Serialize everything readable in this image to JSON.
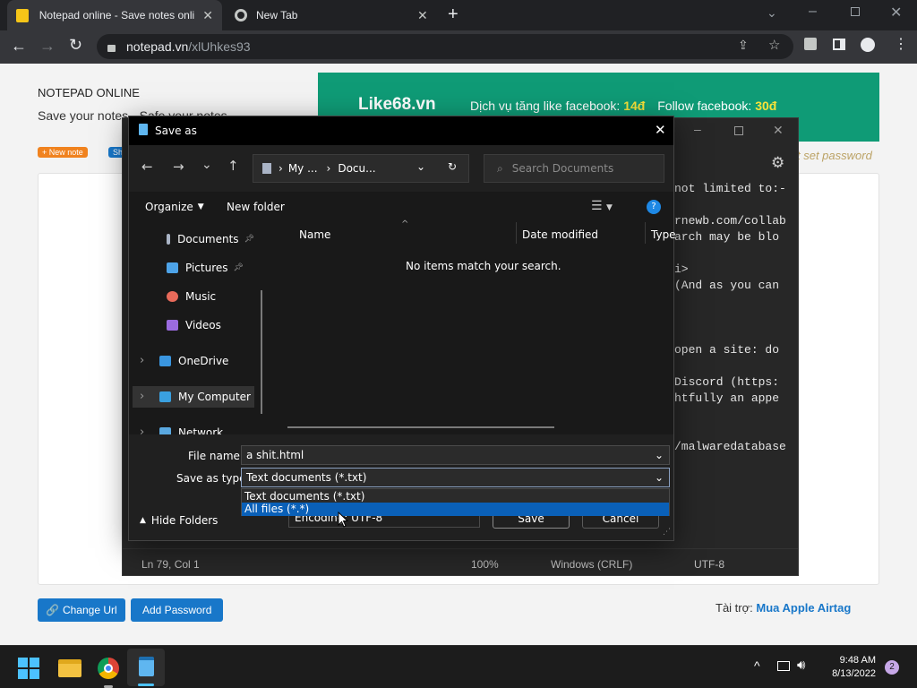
{
  "browser": {
    "tabs": [
      {
        "title": "Notepad online - Save notes onli",
        "active": true
      },
      {
        "title": "New Tab",
        "active": false
      }
    ],
    "url_host": "notepad.vn",
    "url_path": "/xlUhkes93"
  },
  "page": {
    "brand": "NOTEPAD ONLINE",
    "tagline": "Save your notes - Safe your notes",
    "new_note_badge": "+ New note",
    "share_badge": "Sh",
    "ad": {
      "site": "Like68.vn",
      "t1": "Dịch vụ tăng like facebook: ",
      "v1": "14đ",
      "t2": "Follow facebook: ",
      "v2": "30đ"
    },
    "set_password_hint": "t set password",
    "change_url_label": "Change Url",
    "add_password_label": "Add Password",
    "sponsor_label": "Tài trợ: ",
    "sponsor_link": "Mua Apple Airtag"
  },
  "notepad": {
    "visible_lines": [
      "not limited to:-",
      "",
      "rnewb.com/collab",
      "arch may be blo",
      "",
      "i>",
      "(And as you can",
      "",
      "",
      "",
      "open a site: do",
      "",
      "Discord (https:",
      "htfully an appe",
      "",
      "",
      "/malwaredatabase"
    ],
    "status": {
      "position": "Ln 79, Col 1",
      "zoom": "100%",
      "eol": "Windows (CRLF)",
      "encoding": "UTF-8"
    }
  },
  "dialog": {
    "title": "Save as",
    "breadcrumb": [
      "My ...",
      "Docu..."
    ],
    "search_placeholder": "Search Documents",
    "organize_label": "Organize",
    "new_folder_label": "New folder",
    "nav_items": [
      {
        "label": "Documents",
        "icon": "documents-icon",
        "pinned": true
      },
      {
        "label": "Pictures",
        "icon": "pictures-icon",
        "pinned": true
      },
      {
        "label": "Music",
        "icon": "music-icon",
        "pinned": false
      },
      {
        "label": "Videos",
        "icon": "videos-icon",
        "pinned": false
      },
      {
        "label": "OneDrive",
        "icon": "onedrive-icon",
        "expandable": true
      },
      {
        "label": "My Computer",
        "icon": "computer-icon",
        "expandable": true,
        "selected": true
      },
      {
        "label": "Network",
        "icon": "network-icon",
        "expandable": true
      }
    ],
    "columns": [
      "Name",
      "Date modified",
      "Type"
    ],
    "empty_message": "No items match your search.",
    "file_name_label": "File name:",
    "file_name_value": "a shit.html",
    "save_type_label": "Save as type:",
    "save_type_value": "Text documents (*.txt)",
    "type_options": [
      "Text documents (*.txt)",
      "All files  (*.*)"
    ],
    "highlighted_option": 1,
    "encoding_label": "Encoding:",
    "encoding_value": "UTF-8",
    "hide_folders_label": "Hide Folders",
    "save_label": "Save",
    "cancel_label": "Cancel"
  },
  "taskbar": {
    "time": "9:48 AM",
    "date": "8/13/2022",
    "notification_count": "2"
  },
  "colors": {
    "browser_chrome": "#202124",
    "dialog_bg": "#191919",
    "accent_blue": "#1877c9",
    "ad_green": "#0f9b76",
    "selection": "#0a60b8"
  }
}
